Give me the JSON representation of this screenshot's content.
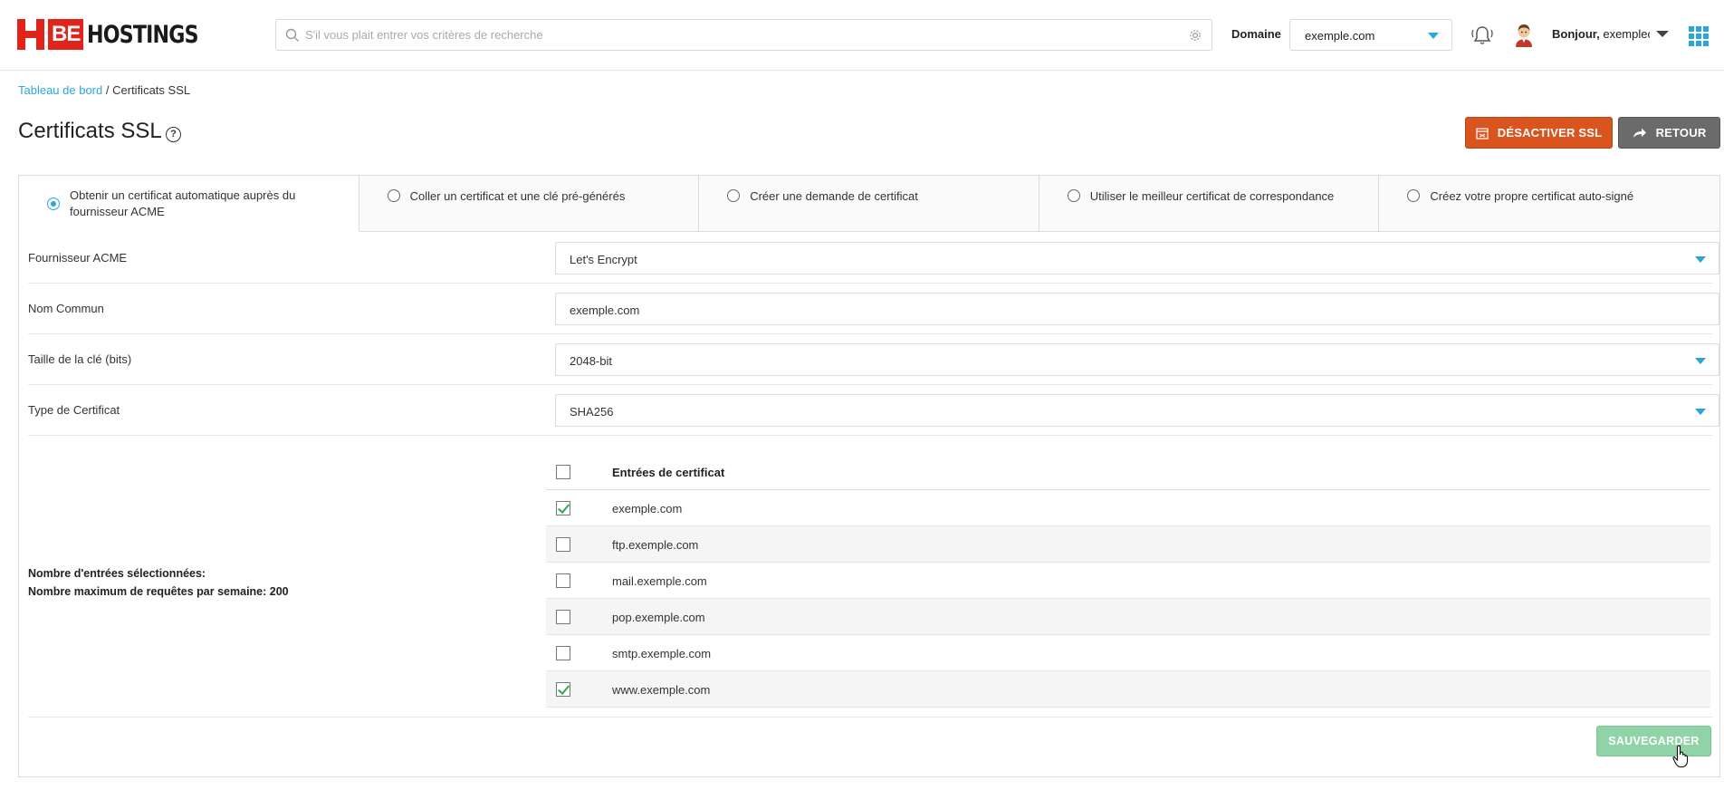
{
  "brand": {
    "mark": "H",
    "be": "BE",
    "name": "HOSTINGS",
    "accent": "#e2231a"
  },
  "search": {
    "placeholder": "S'il vous plait entrer vos critères de recherche",
    "value": ""
  },
  "header": {
    "domain_label": "Domaine",
    "domain_value": "exemple.com",
    "greeting_prefix": "Bonjour,",
    "greeting_user": "exemplec",
    "icons": [
      "bell-icon",
      "avatar",
      "apps-grid-icon"
    ]
  },
  "breadcrumb": {
    "home": "Tableau de bord",
    "separator": "/",
    "current": "Certificats SSL"
  },
  "page": {
    "title": "Certificats SSL",
    "help": "?"
  },
  "actions": {
    "disable_ssl": "DÉSACTIVER SSL",
    "back": "RETOUR",
    "save": "SAUVEGARDER"
  },
  "tabs": [
    {
      "label": "Obtenir un certificat automatique auprès du fournisseur ACME",
      "selected": true
    },
    {
      "label": "Coller un certificat et une clé pré-générés",
      "selected": false
    },
    {
      "label": "Créer une demande de certificat",
      "selected": false
    },
    {
      "label": "Utiliser le meilleur certificat de correspondance",
      "selected": false
    },
    {
      "label": "Créez votre propre certificat auto-signé",
      "selected": false
    }
  ],
  "form": {
    "acme_provider": {
      "label": "Fournisseur ACME",
      "value": "Let's Encrypt"
    },
    "common_name": {
      "label": "Nom Commun",
      "value": "exemple.com"
    },
    "key_size": {
      "label": "Taille de la clé (bits)",
      "value": "2048-bit"
    },
    "cert_type": {
      "label": "Type de Certificat",
      "value": "SHA256"
    }
  },
  "entries": {
    "header": "Entrées de certificat",
    "rows": [
      {
        "name": "exemple.com",
        "checked": true
      },
      {
        "name": "ftp.exemple.com",
        "checked": false
      },
      {
        "name": "mail.exemple.com",
        "checked": false
      },
      {
        "name": "pop.exemple.com",
        "checked": false
      },
      {
        "name": "smtp.exemple.com",
        "checked": false
      },
      {
        "name": "www.exemple.com",
        "checked": true
      }
    ]
  },
  "summary": {
    "selected_label": "Nombre d'entrées sélectionnées:",
    "max_label": "Nombre maximum de requêtes par semaine: 200"
  },
  "colors": {
    "primary": "#29a6de",
    "danger": "#d9541f",
    "neutral": "#6b6b6b",
    "success_light": "#8fd3a6",
    "check": "#2eaa4a"
  }
}
